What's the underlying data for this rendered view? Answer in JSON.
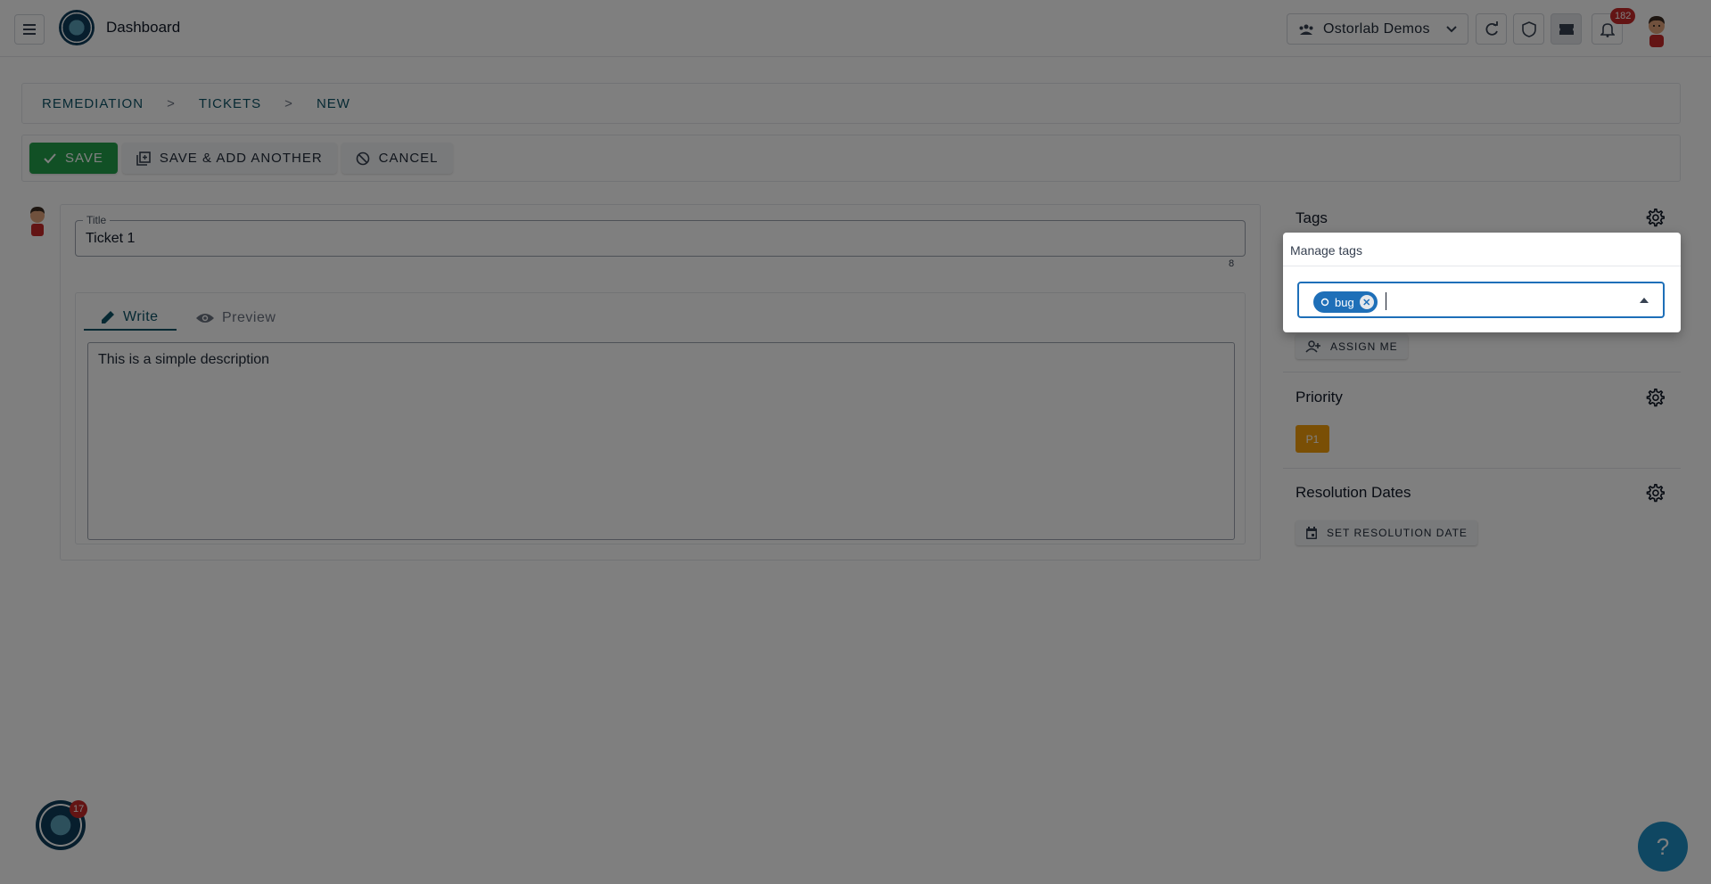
{
  "appbar": {
    "title": "Dashboard",
    "organization": "Ostorlab Demos",
    "notification_count": "182"
  },
  "breadcrumb": {
    "items": [
      "REMEDIATION",
      "TICKETS",
      "NEW"
    ],
    "separator": ">"
  },
  "toolbar": {
    "save_label": "SAVE",
    "save_add_label": "SAVE & ADD ANOTHER",
    "cancel_label": "CANCEL"
  },
  "form": {
    "title_label": "Title",
    "title_value": "Ticket 1",
    "title_char_count": "8",
    "tabs": {
      "write": "Write",
      "preview": "Preview"
    },
    "description": "This is a simple description"
  },
  "sidebar": {
    "tags_title": "Tags",
    "assign_me_label": "ASSIGN ME",
    "priority_title": "Priority",
    "priority_value": "P1",
    "resolution_title": "Resolution Dates",
    "set_resolution_label": "SET RESOLUTION DATE"
  },
  "tags_popover": {
    "title": "Manage tags",
    "selected_tags": [
      "bug"
    ]
  },
  "bottom": {
    "assistant_badge": "17",
    "help_label": "?"
  },
  "colors": {
    "primary": "#22a04b",
    "accent": "#1e6fb8",
    "brand": "#0d5266",
    "priority": "#f59e0b",
    "badge": "#c62828",
    "help": "#1e8fc5"
  },
  "icons": [
    "menu-icon",
    "logo-icon",
    "group-icon",
    "chevron-down-icon",
    "refresh-icon",
    "shield-icon",
    "ticket-icon",
    "bell-icon",
    "check-icon",
    "copy-icon",
    "ban-icon",
    "pencil-icon",
    "eye-icon",
    "gear-icon",
    "person-add-icon",
    "calendar-icon",
    "tag-icon",
    "close-circle-icon"
  ]
}
